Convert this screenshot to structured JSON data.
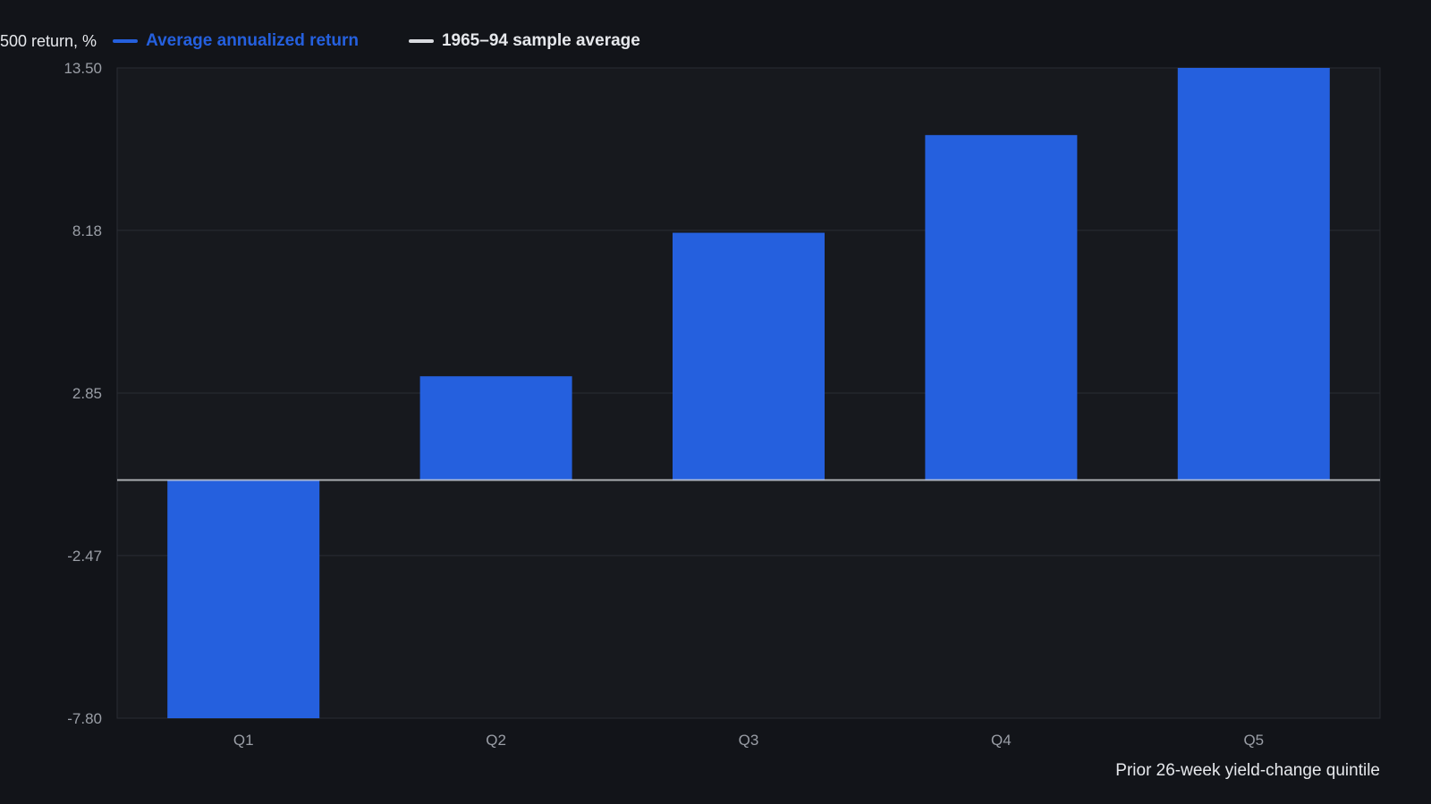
{
  "chart_data": {
    "type": "bar",
    "title": "",
    "ylabel": "500 return, %",
    "xlabel": "Prior 26-week yield-change quintile",
    "categories": [
      "Q1",
      "Q2",
      "Q3",
      "Q4",
      "Q5"
    ],
    "series": [
      {
        "name": "Average annualized return",
        "values": [
          -7.8,
          3.4,
          8.1,
          11.3,
          13.5
        ],
        "color": "#2560de"
      }
    ],
    "reference_line": {
      "name": "1965–94 sample average",
      "value": 0.0,
      "color": "#d9dbe0"
    },
    "ylim": [
      -7.8,
      13.5
    ],
    "yticks": [
      "13.50",
      "8.18",
      "2.85",
      "-2.47",
      "-7.80"
    ],
    "ytick_values": [
      13.5,
      8.18,
      2.85,
      -2.47,
      -7.8
    ],
    "grid": true,
    "legend_position": "top-left",
    "colors": {
      "background": "#121419",
      "plot_background": "#17191e",
      "grid": "#2a2d34",
      "axis_text": "#9a9ea6",
      "text": "#e6e8ec"
    }
  }
}
